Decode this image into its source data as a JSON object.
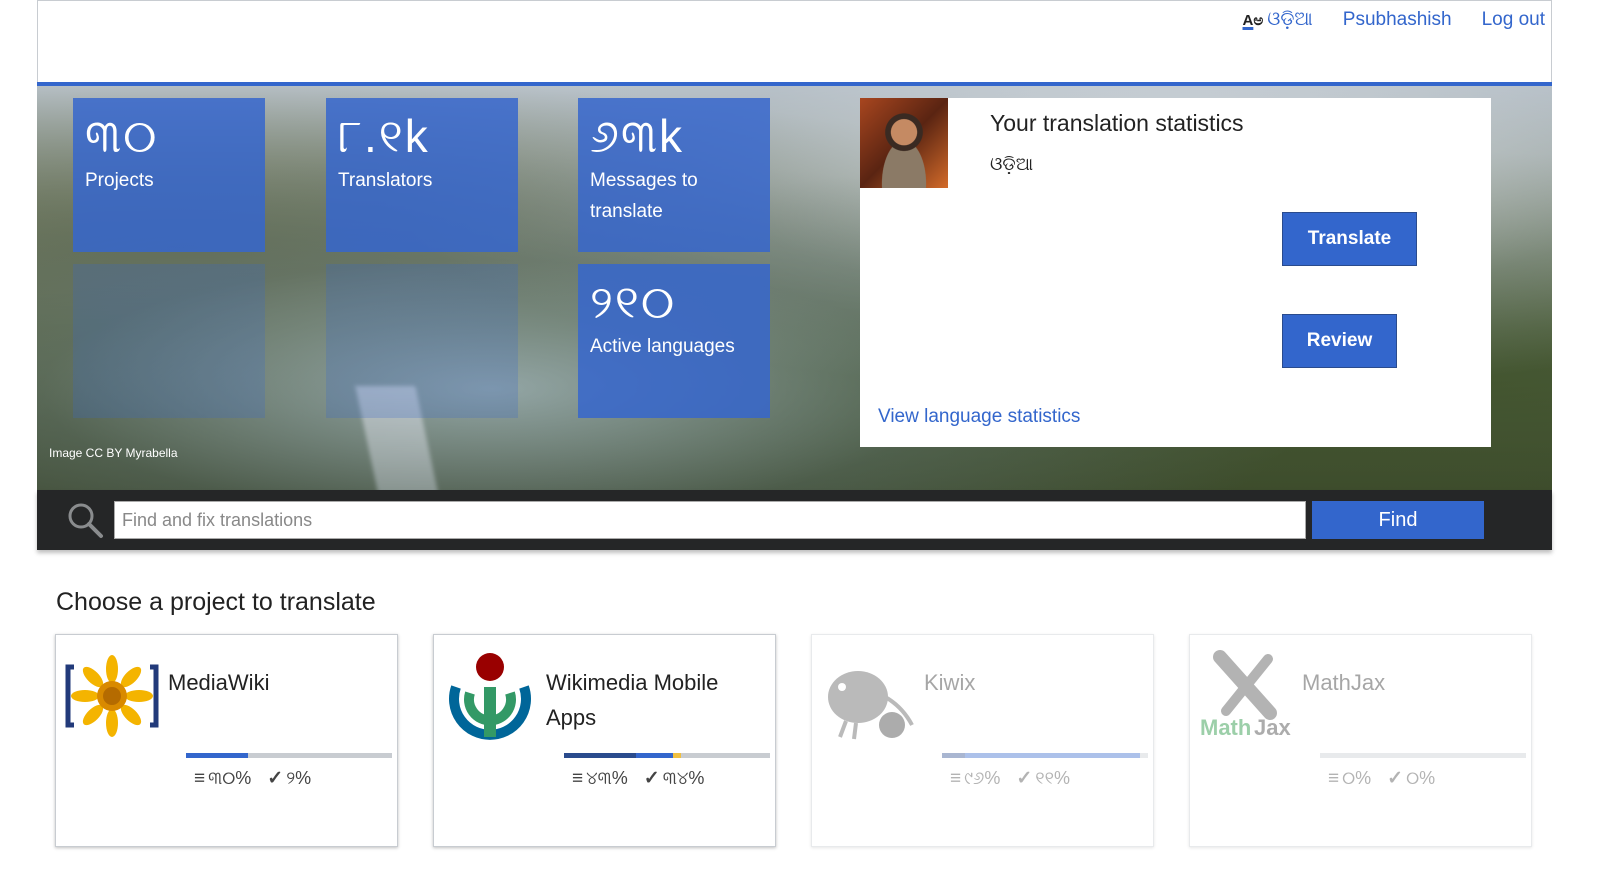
{
  "topbar": {
    "language": "ଓଡ଼ିଆ",
    "language_icon": "language-selector-icon",
    "username": "Psubhashish",
    "logout": "Log out"
  },
  "hero": {
    "tiles": [
      {
        "number": "୩୦",
        "label": "Projects"
      },
      {
        "number": "୮.୧k",
        "label": "Translators"
      },
      {
        "number": "୬୩k",
        "label": "Messages to translate"
      },
      {
        "number": "୨୧୦",
        "label": "Active languages"
      }
    ],
    "credit": "Image CC BY Myrabella"
  },
  "stats_panel": {
    "title": "Your translation statistics",
    "language": "ଓଡ଼ିଆ",
    "translate_button": "Translate",
    "review_button": "Review",
    "view_link": "View language statistics"
  },
  "search": {
    "placeholder": "Find and fix translations",
    "value": "",
    "button": "Find"
  },
  "projects": {
    "heading": "Choose a project to translate",
    "items": [
      {
        "name": "MediaWiki",
        "translated": "୩୦%",
        "proofread": "୨%",
        "translated_pct": 30,
        "proofread_pct": 0
      },
      {
        "name": "Wikimedia Mobile Apps",
        "translated": "୪୩%",
        "proofread": "୩୪%",
        "translated_pct": 35,
        "proofread_pct": 18
      },
      {
        "name": "Kiwix",
        "translated": "୯୬%",
        "proofread": "୧୧%",
        "translated_pct": 11,
        "proofread_pct": 85
      },
      {
        "name": "MathJax",
        "translated": "୦%",
        "proofread": "୦%",
        "translated_pct": 0,
        "proofread_pct": 0
      }
    ]
  },
  "colors": {
    "accent": "#3366cc",
    "dark_bar": "#252627"
  }
}
